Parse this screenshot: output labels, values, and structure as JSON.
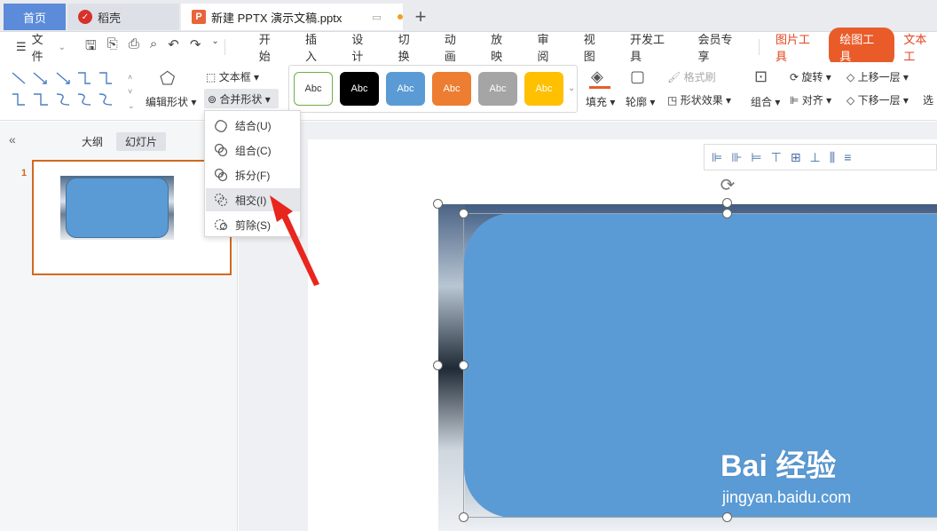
{
  "tabs": {
    "home": "首页",
    "daoke": "稻壳",
    "doc": "新建 PPTX 演示文稿.pptx",
    "add": "+"
  },
  "menubar": {
    "file": "文件",
    "items": [
      "开始",
      "插入",
      "设计",
      "切换",
      "动画",
      "放映",
      "审阅",
      "视图",
      "开发工具",
      "会员专享"
    ],
    "picture_tools": "图片工具",
    "drawing_tools": "绘图工具",
    "text_tools": "文本工"
  },
  "ribbon": {
    "edit_shape": "编辑形状",
    "text_box": "文本框",
    "merge_shape": "合并形状",
    "styles": [
      "Abc",
      "Abc",
      "Abc",
      "Abc",
      "Abc",
      "Abc"
    ],
    "style_colors": [
      "#ffffff",
      "#000000",
      "#5b9bd5",
      "#ed7d31",
      "#a5a5a5",
      "#ffc000"
    ],
    "fill": "填充",
    "outline": "轮廓",
    "format_painter": "格式刷",
    "shape_effects": "形状效果",
    "group": "组合",
    "rotate": "旋转",
    "align": "对齐",
    "bring_forward": "上移一层",
    "send_backward": "下移一层",
    "select": "选"
  },
  "leftpanel": {
    "collapse": "«",
    "outline": "大纲",
    "slides": "幻灯片",
    "slide_number": "1"
  },
  "merge_menu": {
    "items": [
      {
        "label": "结合(U)"
      },
      {
        "label": "组合(C)"
      },
      {
        "label": "拆分(F)"
      },
      {
        "label": "相交(I)"
      },
      {
        "label": "剪除(S)"
      }
    ],
    "active_index": 3
  },
  "watermark": {
    "logo": "Bai 经验",
    "url": "jingyan.baidu.com"
  },
  "colors": {
    "accent": "#e95c2a",
    "shape_fill": "#5b9bd5",
    "home_tab": "#5b8bd9"
  }
}
